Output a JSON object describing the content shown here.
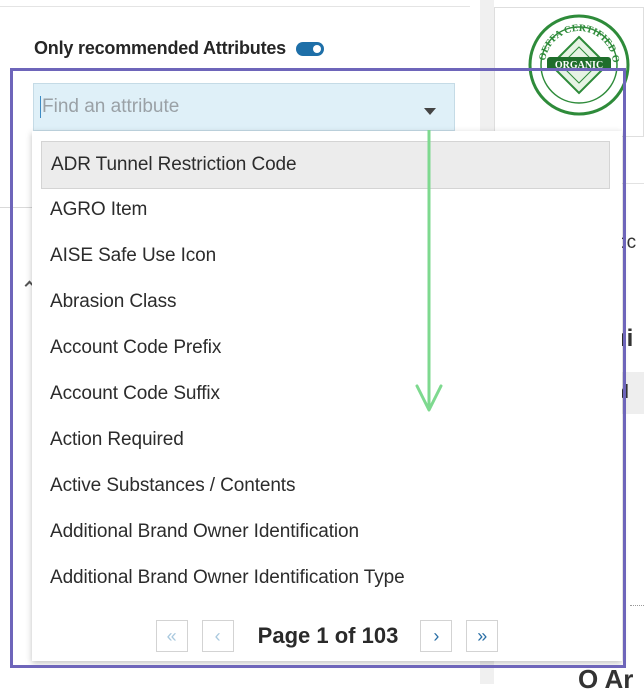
{
  "filter": {
    "label": "Only recommended Attributes",
    "toggle_on": true
  },
  "search": {
    "placeholder": "Find an attribute",
    "value": ""
  },
  "options": [
    {
      "label": "ADR Tunnel Restriction Code",
      "highlighted": true
    },
    {
      "label": "AGRO Item"
    },
    {
      "label": "AISE Safe Use Icon"
    },
    {
      "label": "Abrasion Class"
    },
    {
      "label": "Account Code Prefix"
    },
    {
      "label": "Account Code Suffix"
    },
    {
      "label": "Action Required"
    },
    {
      "label": "Active Substances / Contents"
    },
    {
      "label": "Additional Brand Owner Identification"
    },
    {
      "label": "Additional Brand Owner Identification Type"
    }
  ],
  "pagination": {
    "first_icon": "«",
    "prev_icon": "‹",
    "page_label": "Page 1 of 103",
    "next_icon": "›",
    "last_icon": "»",
    "current_page": 1,
    "total_pages": 103
  },
  "background": {
    "seal_top_text": "OEFFA CERTIFIED ORGANIC",
    "seal_center_text": "ORGANIC",
    "fragment_1": "oc",
    "fragment_2": "ni",
    "fragment_3": "al",
    "fragment_4": "O Ar"
  },
  "colors": {
    "highlight_border": "#6e65ba",
    "toggle": "#1e6fa8",
    "search_bg": "#dff0f8",
    "scroll_hint_arrow": "#7ed98f",
    "seal_green": "#2e8b3a"
  },
  "icons": {
    "dropdown": "caret-down-icon",
    "scroll_hint": "arrow-down-icon"
  }
}
